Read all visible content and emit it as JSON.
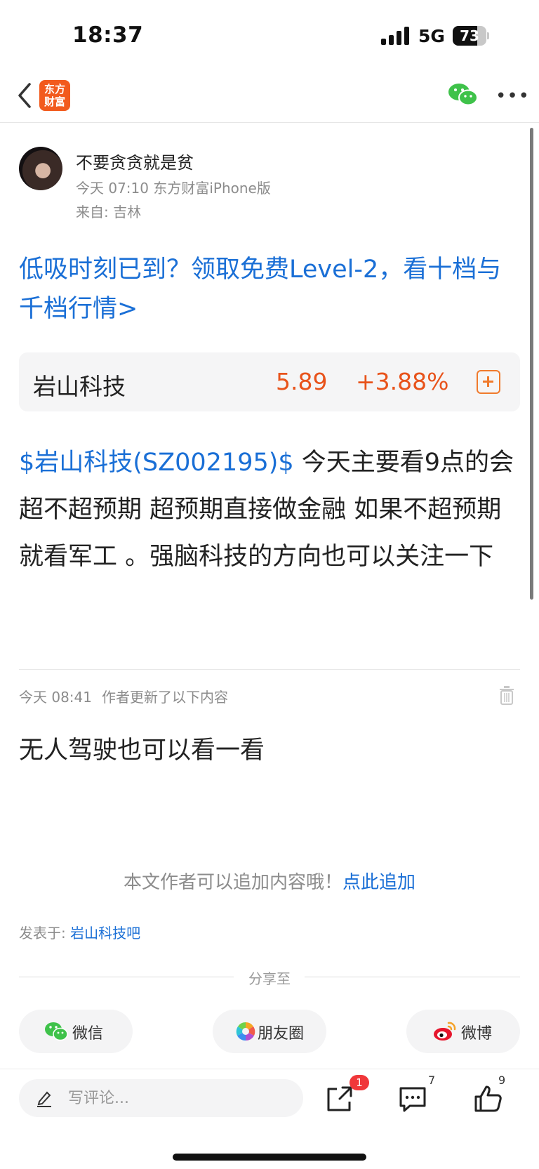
{
  "status_bar": {
    "time": "18:37",
    "network": "5G",
    "battery": "73",
    "battery_level": 0.73
  },
  "nav": {
    "logo_text": "东方\n财富"
  },
  "post": {
    "author": "不要贪贪就是贫",
    "meta": "今天 07:10 东方财富iPhone版",
    "from": "来自: 吉林",
    "promo": "低吸时刻已到？领取免费Level-2，看十档与千档行情>",
    "stock": {
      "name": "岩山科技",
      "price": "5.89",
      "change": "+3.88%"
    },
    "body_link": "$岩山科技(SZ002195)$",
    "body_text": " 今天主要看9点的会超不超预期 超预期直接做金融 如果不超预期就看军工 。强脑科技的方向也可以关注一下",
    "update_time": "今天 08:41",
    "update_label": "作者更新了以下内容",
    "update_body": "无人驾驶也可以看一看",
    "append_note": "本文作者可以追加内容哦！",
    "append_link": "点此追加",
    "posted_in_label": "发表于: ",
    "posted_in_bar": "岩山科技吧"
  },
  "share": {
    "title": "分享至",
    "items": [
      {
        "label": "微信",
        "icon": "wechat-icon"
      },
      {
        "label": "朋友圈",
        "icon": "moments-icon"
      },
      {
        "label": "微博",
        "icon": "weibo-icon"
      }
    ]
  },
  "bottom": {
    "comment_placeholder": "写评论...",
    "share_badge": "1",
    "comment_count": "7",
    "like_count": "9"
  }
}
